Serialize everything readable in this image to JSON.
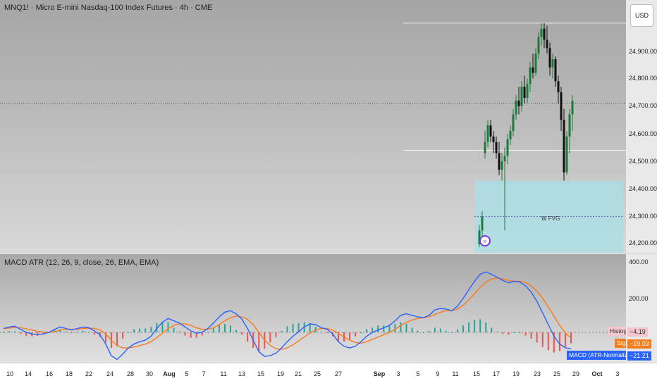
{
  "header": {
    "title": "MNQ1! · Micro E-mini Nasdaq-100 Index Futures · 4h · CME"
  },
  "currency_button": "USD",
  "price_scale": {
    "labels": [
      "24,900.00",
      "24,800.00",
      "24,700.00",
      "24,600.00",
      "24,500.00",
      "24,400.00",
      "24,300.00",
      "24,200.00"
    ],
    "values": [
      24900,
      24800,
      24700,
      24600,
      24500,
      24400,
      24300,
      24200
    ]
  },
  "fvg_label": "W FVG",
  "logo_glyph": "»",
  "indicator": {
    "title": "MACD ATR (12, 26, 9, close, 26, EMA, EMA)",
    "scale_labels": [
      "400.00",
      "200.00"
    ],
    "legend": [
      {
        "name": "Histogram",
        "value": "−4.19",
        "color": "#f4c7cc"
      },
      {
        "name": "Signal",
        "value": "−19.03",
        "color": "#f57c1f"
      },
      {
        "name": "MACD (ATR-Normalized)",
        "value": "−21.21",
        "color": "#2962ff"
      }
    ]
  },
  "time_axis": {
    "labels": [
      "10",
      "14",
      "16",
      "18",
      "22",
      "24",
      "28",
      "30",
      "Aug",
      "5",
      "7",
      "11",
      "13",
      "15",
      "19",
      "21",
      "25",
      "27",
      "Sep",
      "3",
      "5",
      "9",
      "11",
      "15",
      "17",
      "19",
      "23",
      "25",
      "29",
      "Oct",
      "3"
    ]
  },
  "colors": {
    "up": "#1e7a3a",
    "down": "#111111",
    "macd": "#2962ff",
    "signal": "#f57c1f",
    "hist_up": "#26a69a",
    "hist_down": "#ef5350",
    "fvg": "#a9e0e6"
  },
  "chart_data": {
    "type": "candlestick",
    "title": "MNQ1! · Micro E-mini Nasdaq-100 Index Futures · 4h · CME",
    "ylim": [
      24150,
      25000
    ],
    "ohlc": [
      [
        24190,
        24260,
        24180,
        24240
      ],
      [
        24240,
        24310,
        24220,
        24290
      ],
      [
        24520,
        24600,
        24500,
        24560
      ],
      [
        24560,
        24640,
        24540,
        24620
      ],
      [
        24620,
        24640,
        24560,
        24580
      ],
      [
        24580,
        24600,
        24520,
        24560
      ],
      [
        24560,
        24580,
        24500,
        24520
      ],
      [
        24520,
        24560,
        24440,
        24460
      ],
      [
        24460,
        24520,
        24420,
        24490
      ],
      [
        24490,
        24540,
        24240,
        24510
      ],
      [
        24510,
        24590,
        24480,
        24570
      ],
      [
        24570,
        24620,
        24550,
        24600
      ],
      [
        24600,
        24680,
        24580,
        24660
      ],
      [
        24660,
        24730,
        24640,
        24710
      ],
      [
        24710,
        24760,
        24660,
        24690
      ],
      [
        24690,
        24780,
        24670,
        24760
      ],
      [
        24760,
        24800,
        24700,
        24720
      ],
      [
        24720,
        24790,
        24700,
        24770
      ],
      [
        24770,
        24850,
        24740,
        24830
      ],
      [
        24830,
        24880,
        24790,
        24810
      ],
      [
        24810,
        24900,
        24800,
        24880
      ],
      [
        24880,
        24960,
        24860,
        24940
      ],
      [
        24940,
        24990,
        24910,
        24970
      ],
      [
        24970,
        24990,
        24900,
        24930
      ],
      [
        24930,
        24980,
        24880,
        24900
      ],
      [
        24900,
        24920,
        24800,
        24830
      ],
      [
        24830,
        24880,
        24790,
        24860
      ],
      [
        24860,
        24870,
        24760,
        24780
      ],
      [
        24780,
        24800,
        24700,
        24740
      ],
      [
        24740,
        24760,
        24600,
        24640
      ],
      [
        24640,
        24680,
        24420,
        24450
      ],
      [
        24450,
        24600,
        24440,
        24580
      ],
      [
        24580,
        24680,
        24520,
        24660
      ],
      [
        24660,
        24730,
        24600,
        24710
      ]
    ],
    "fvg_zone": {
      "label": "W FVG",
      "top": 24420,
      "bottom": 24190,
      "mid": 24290
    },
    "horizontal_lines": [
      24990,
      24700,
      24530
    ],
    "macd": {
      "ylim": [
        -120,
        420
      ],
      "macd_line": [
        10,
        14,
        16,
        8,
        0,
        -4,
        -6,
        -4,
        0,
        8,
        14,
        10,
        6,
        10,
        14,
        12,
        4,
        -6,
        -30,
        -60,
        -70,
        -56,
        -40,
        -30,
        -24,
        -20,
        -10,
        10,
        26,
        36,
        30,
        24,
        14,
        4,
        -2,
        0,
        10,
        24,
        40,
        52,
        56,
        48,
        34,
        10,
        -20,
        -50,
        -62,
        -60,
        -54,
        -40,
        -24,
        -10,
        2,
        14,
        22,
        20,
        12,
        8,
        -4,
        -24,
        -36,
        -40,
        -36,
        -24,
        -10,
        0,
        6,
        12,
        18,
        30,
        44,
        48,
        44,
        40,
        38,
        44,
        58,
        62,
        60,
        56,
        68,
        88,
        110,
        132,
        150,
        156,
        150,
        142,
        134,
        128,
        132,
        130,
        120,
        104,
        80,
        50,
        20,
        -10,
        -30,
        -40,
        -42
      ],
      "signal_line": [
        10,
        11,
        13,
        12,
        9,
        6,
        3,
        1,
        0,
        2,
        6,
        8,
        8,
        8,
        10,
        11,
        10,
        6,
        -4,
        -20,
        -34,
        -40,
        -40,
        -38,
        -34,
        -30,
        -24,
        -14,
        -2,
        10,
        18,
        22,
        22,
        18,
        12,
        8,
        8,
        12,
        20,
        30,
        38,
        42,
        40,
        34,
        20,
        0,
        -20,
        -34,
        -42,
        -44,
        -40,
        -32,
        -22,
        -12,
        -2,
        6,
        10,
        10,
        6,
        -2,
        -12,
        -20,
        -26,
        -28,
        -24,
        -18,
        -12,
        -6,
        0,
        8,
        18,
        26,
        32,
        36,
        38,
        40,
        46,
        52,
        56,
        56,
        60,
        70,
        84,
        100,
        116,
        130,
        138,
        140,
        138,
        134,
        132,
        132,
        128,
        120,
        106,
        88,
        66,
        42,
        18,
        -2,
        -14
      ],
      "histogram": [
        0,
        3,
        3,
        -4,
        -9,
        -10,
        -9,
        -5,
        0,
        6,
        8,
        2,
        -2,
        2,
        4,
        1,
        -6,
        -12,
        -26,
        -40,
        -36,
        -16,
        0,
        8,
        10,
        10,
        14,
        24,
        28,
        26,
        12,
        2,
        -8,
        -14,
        -14,
        -8,
        2,
        12,
        20,
        22,
        18,
        6,
        -6,
        -24,
        -40,
        -50,
        -42,
        -26,
        -12,
        4,
        16,
        22,
        24,
        26,
        24,
        14,
        2,
        -2,
        -10,
        -22,
        -24,
        -20,
        -10,
        0,
        8,
        12,
        18,
        18,
        18,
        22,
        26,
        22,
        12,
        4,
        0,
        4,
        12,
        10,
        4,
        0,
        8,
        18,
        26,
        32,
        34,
        26,
        12,
        2,
        -4,
        -6,
        0,
        -2,
        -8,
        -16,
        -26,
        -38,
        -46,
        -52,
        -48,
        -38,
        -28
      ]
    }
  }
}
